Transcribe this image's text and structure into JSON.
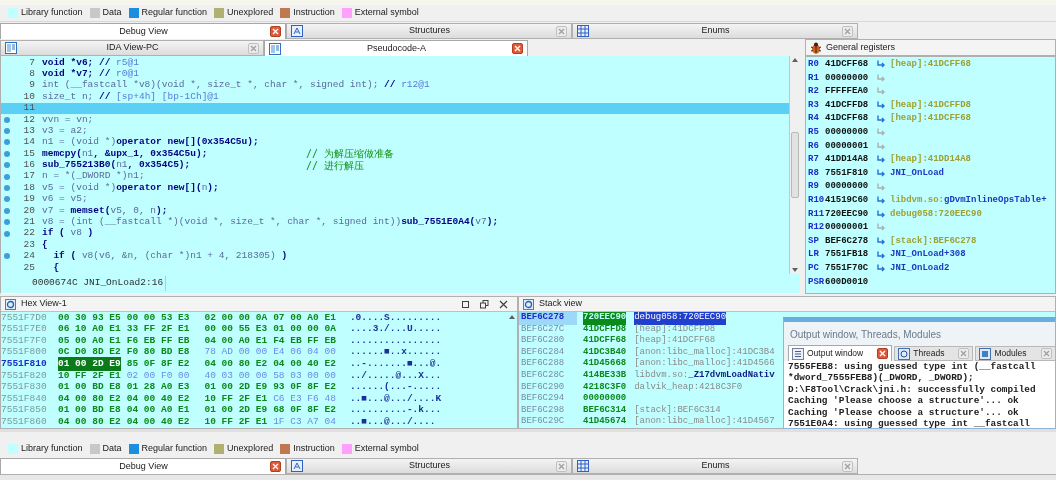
{
  "legend": [
    {
      "label": "Library function",
      "color": "#c0ffff"
    },
    {
      "label": "Data",
      "color": "#c8c8c8"
    },
    {
      "label": "Regular function",
      "color": "#1c8ee0"
    },
    {
      "label": "Unexplored",
      "color": "#b0b070"
    },
    {
      "label": "Instruction",
      "color": "#c07850"
    },
    {
      "label": "External symbol",
      "color": "#ffa0ff"
    }
  ],
  "top_tabs": [
    {
      "label": "Debug View",
      "selected": true
    },
    {
      "label": "Structures",
      "selected": false,
      "kind": "struct"
    },
    {
      "label": "Enums",
      "selected": false,
      "kind": "enum"
    }
  ],
  "editor_tabs": [
    {
      "label": "IDA View-PC",
      "selected": false,
      "kind": "view"
    },
    {
      "label": "Pseudocode-A",
      "selected": true,
      "kind": "view"
    }
  ],
  "pseudocode": {
    "lines": [
      {
        "number": "7",
        "breakpoint": false,
        "selected": false,
        "code": [
          {
            "kind": "kw",
            "text": "void *v6; //"
          },
          {
            "kind": "ref",
            "text": " r5@1"
          }
        ]
      },
      {
        "number": "8",
        "breakpoint": false,
        "selected": false,
        "code": [
          {
            "kind": "kw",
            "text": "void *v7; //"
          },
          {
            "kind": "ref",
            "text": " r0@1"
          }
        ]
      },
      {
        "number": "9",
        "breakpoint": false,
        "selected": false,
        "code": [
          {
            "kind": "id",
            "text": "int (__fastcall *v8)(void *, size_t *, char *, signed int);"
          },
          {
            "kind": "kw",
            "text": " //"
          },
          {
            "kind": "ref",
            "text": " r12@1"
          }
        ]
      },
      {
        "number": "10",
        "breakpoint": false,
        "selected": false,
        "code": [
          {
            "kind": "id",
            "text": "size_t n;"
          },
          {
            "kind": "kw",
            "text": " //"
          },
          {
            "kind": "ref",
            "text": " [sp+4h] [bp-1Ch]@1"
          }
        ]
      },
      {
        "number": "11",
        "breakpoint": false,
        "selected": true
      },
      {
        "number": "12",
        "breakpoint": true,
        "selected": false,
        "code": [
          {
            "kind": "id",
            "text": "vvn = vn;"
          }
        ]
      },
      {
        "number": "13",
        "breakpoint": true,
        "selected": false,
        "code": [
          {
            "kind": "id",
            "text": "v3 = a2;"
          }
        ]
      },
      {
        "number": "14",
        "breakpoint": true,
        "selected": false,
        "code": [
          {
            "kind": "id",
            "text": "n1 = (void *)"
          },
          {
            "kind": "kw",
            "text": "operator new[](0x354C5u);"
          }
        ]
      },
      {
        "number": "15",
        "breakpoint": true,
        "selected": false,
        "code": [
          {
            "kind": "kw",
            "text": "memcpy("
          },
          {
            "kind": "id",
            "text": "n1"
          },
          {
            "kind": "kw",
            "text": ", &upx_1, 0x354C5u);"
          }
        ],
        "comment": "// 为解压缩做准备"
      },
      {
        "number": "16",
        "breakpoint": true,
        "selected": false,
        "code": [
          {
            "kind": "kw",
            "text": "sub_755213B0("
          },
          {
            "kind": "id",
            "text": "n1"
          },
          {
            "kind": "kw",
            "text": ", 0x354C5);"
          }
        ],
        "comment": "// 进行解压"
      },
      {
        "number": "17",
        "breakpoint": true,
        "selected": false,
        "code": [
          {
            "kind": "id",
            "text": "n = *(_DWORD *)n1;"
          }
        ]
      },
      {
        "number": "18",
        "breakpoint": true,
        "selected": false,
        "code": [
          {
            "kind": "id",
            "text": "v5 = (void *)"
          },
          {
            "kind": "kw",
            "text": "operator new[]("
          },
          {
            "kind": "id",
            "text": "n"
          },
          {
            "kind": "kw",
            "text": ");"
          }
        ]
      },
      {
        "number": "19",
        "breakpoint": true,
        "selected": false,
        "code": [
          {
            "kind": "id",
            "text": "v6 = v5;"
          }
        ]
      },
      {
        "number": "20",
        "breakpoint": true,
        "selected": false,
        "code": [
          {
            "kind": "id",
            "text": "v7 = "
          },
          {
            "kind": "kw",
            "text": "memset("
          },
          {
            "kind": "id",
            "text": "v5, 0, n"
          },
          {
            "kind": "kw",
            "text": ");"
          }
        ]
      },
      {
        "number": "21",
        "breakpoint": true,
        "selected": false,
        "code": [
          {
            "kind": "id",
            "text": "v8 = (int (__fastcall *)(void *, size_t *, char *, signed int))"
          },
          {
            "kind": "kw",
            "text": "sub_7551E0A4("
          },
          {
            "kind": "id",
            "text": "v7"
          },
          {
            "kind": "kw",
            "text": ");"
          }
        ]
      },
      {
        "number": "22",
        "breakpoint": true,
        "selected": false,
        "code": [
          {
            "kind": "kw",
            "text": "if ( "
          },
          {
            "kind": "id",
            "text": "v8"
          },
          {
            "kind": "kw",
            "text": " )"
          }
        ]
      },
      {
        "number": "23",
        "breakpoint": false,
        "selected": false,
        "code": [
          {
            "kind": "kw",
            "text": "{"
          }
        ]
      },
      {
        "number": "24",
        "breakpoint": true,
        "selected": false,
        "code": [
          {
            "kind": "kw",
            "text": "  if ( "
          },
          {
            "kind": "id",
            "text": "v8(v6, &n, (char *)n1 + 4, 218305)"
          },
          {
            "kind": "kw",
            "text": " )"
          }
        ]
      },
      {
        "number": "25",
        "breakpoint": false,
        "selected": false,
        "code": [
          {
            "kind": "kw",
            "text": "  {"
          }
        ]
      }
    ],
    "status": "0000674C JNI_OnLoad2:16"
  },
  "registers": {
    "title": "General registers",
    "rows": [
      {
        "name": "R0",
        "value": "41DCFF68",
        "arrow": true,
        "reference": "[heap]:41DCFF68",
        "kind": "data"
      },
      {
        "name": "R1",
        "value": "00000000",
        "arrow": true
      },
      {
        "name": "R2",
        "value": "FFFFFEA0",
        "arrow": true
      },
      {
        "name": "R3",
        "value": "41DCFFD8",
        "arrow": true,
        "reference": "[heap]:41DCFFD8",
        "kind": "data"
      },
      {
        "name": "R4",
        "value": "41DCFF68",
        "arrow": true,
        "reference": "[heap]:41DCFF68",
        "kind": "data"
      },
      {
        "name": "R5",
        "value": "00000000",
        "arrow": true
      },
      {
        "name": "R6",
        "value": "00000001",
        "arrow": true
      },
      {
        "name": "R7",
        "value": "41DD14A8",
        "arrow": true,
        "reference": "[heap]:41DD14A8",
        "kind": "data"
      },
      {
        "name": "R8",
        "value": "7551F810",
        "arrow": true,
        "reference": "JNI_OnLoad",
        "kind": "code"
      },
      {
        "name": "R9",
        "value": "00000000",
        "arrow": true
      },
      {
        "name": "R10",
        "value": "41519C60",
        "arrow": true,
        "prefix": "libdvm.so:",
        "reference": "gDvmInlineOpsTable+",
        "kind": "code"
      },
      {
        "name": "R11",
        "value": "720EEC90",
        "arrow": true,
        "reference": "debug058:720EEC90",
        "kind": "data"
      },
      {
        "name": "R12",
        "value": "00000001",
        "arrow": true
      },
      {
        "name": "SP",
        "value": "BEF6C278",
        "arrow": true,
        "reference": "[stack]:BEF6C278",
        "kind": "data"
      },
      {
        "name": "LR",
        "value": "7551FB18",
        "arrow": true,
        "reference": "JNI_OnLoad+308",
        "kind": "code"
      },
      {
        "name": "PC",
        "value": "7551F70C",
        "arrow": true,
        "reference": "JNI_OnLoad2",
        "kind": "code"
      },
      {
        "name": "PSR",
        "value": "600D0010",
        "arrow": false
      }
    ]
  },
  "hex_view": {
    "title": "Hex View-1",
    "rows": [
      {
        "address": "7551F7D0",
        "selected": false,
        "words": [
          {
            "text": "00 30 93 E5",
            "kind": "code",
            "selected": false
          },
          {
            "text": "00 00 53 E3",
            "kind": "code",
            "selected": false
          },
          {
            "text": "02 00 00 0A",
            "kind": "code",
            "selected": false
          },
          {
            "text": "07 00 A0 E1",
            "kind": "code",
            "selected": false
          }
        ],
        "ascii": ".0....S........."
      },
      {
        "address": "7551F7E0",
        "selected": false,
        "words": [
          {
            "text": "06 10 A0 E1",
            "kind": "code",
            "selected": false
          },
          {
            "text": "33 FF 2F E1",
            "kind": "code",
            "selected": false
          },
          {
            "text": "00 00 55 E3",
            "kind": "code",
            "selected": false
          },
          {
            "text": "01 00 00 0A",
            "kind": "code",
            "selected": false
          }
        ],
        "ascii": "....3./...U....."
      },
      {
        "address": "7551F7F0",
        "selected": false,
        "words": [
          {
            "text": "05 00 A0 E1",
            "kind": "code",
            "selected": false
          },
          {
            "text": "F6 EB FF EB",
            "kind": "code",
            "selected": false
          },
          {
            "text": "04 00 A0 E1",
            "kind": "code",
            "selected": false
          },
          {
            "text": "F4 EB FF EB",
            "kind": "code",
            "selected": false
          }
        ],
        "ascii": "................"
      },
      {
        "address": "7551F800",
        "selected": false,
        "words": [
          {
            "text": "0C D0 8D E2",
            "kind": "code",
            "selected": false
          },
          {
            "text": "F0 80 BD E8",
            "kind": "code",
            "selected": false
          },
          {
            "text": "78 AD 00 00",
            "kind": "data",
            "selected": false
          },
          {
            "text": "E4 06 04 00",
            "kind": "data",
            "selected": false
          }
        ],
        "ascii": "......■..x......"
      },
      {
        "address": "7551F810",
        "selected": true,
        "words": [
          {
            "text": "01 00 2D E9",
            "kind": "code",
            "selected": true
          },
          {
            "text": "85 0F 8F E2",
            "kind": "code",
            "selected": false
          },
          {
            "text": "04 00 80 E2",
            "kind": "code",
            "selected": false
          },
          {
            "text": "04 00 40 E2",
            "kind": "code",
            "selected": false
          }
        ],
        "ascii": "..-.......■...@."
      },
      {
        "address": "7551F820",
        "selected": false,
        "words": [
          {
            "text": "10 FF 2F E1",
            "kind": "code",
            "selected": false
          },
          {
            "text": "02 00 F0 00",
            "kind": "data",
            "selected": false
          },
          {
            "text": "40 03 00 00",
            "kind": "data",
            "selected": false
          },
          {
            "text": "58 03 00 00",
            "kind": "data",
            "selected": false
          }
        ],
        "ascii": "../.....@...X..."
      },
      {
        "address": "7551F830",
        "selected": false,
        "words": [
          {
            "text": "01 00 BD E8",
            "kind": "code",
            "selected": false
          },
          {
            "text": "01 28 A0 E3",
            "kind": "code",
            "selected": false
          },
          {
            "text": "01 00 2D E9",
            "kind": "code",
            "selected": false
          },
          {
            "text": "93 0F 8F E2",
            "kind": "code",
            "selected": false
          }
        ],
        "ascii": "......(...-....."
      },
      {
        "address": "7551F840",
        "selected": false,
        "words": [
          {
            "text": "04 00 80 E2",
            "kind": "code",
            "selected": false
          },
          {
            "text": "04 00 40 E2",
            "kind": "code",
            "selected": false
          },
          {
            "text": "10 FF 2F E1",
            "kind": "code",
            "selected": false
          },
          {
            "text": "C6 E3 F6 48",
            "kind": "data",
            "selected": false
          }
        ],
        "ascii": "..■...@.../....K"
      },
      {
        "address": "7551F850",
        "selected": false,
        "words": [
          {
            "text": "01 00 BD E8",
            "kind": "code",
            "selected": false
          },
          {
            "text": "04 00 A0 E1",
            "kind": "code",
            "selected": false
          },
          {
            "text": "01 00 2D E9",
            "kind": "code",
            "selected": false
          },
          {
            "text": "68 0F 8F E2",
            "kind": "code",
            "selected": false
          }
        ],
        "ascii": "..........-.k..."
      },
      {
        "address": "7551F860",
        "selected": false,
        "words": [
          {
            "text": "04 00 80 E2",
            "kind": "code",
            "selected": false
          },
          {
            "text": "04 00 40 E2",
            "kind": "code",
            "selected": false
          },
          {
            "text": "10 FF 2F E1",
            "kind": "code",
            "selected": false
          },
          {
            "text": "1F C3 A7 04",
            "kind": "data",
            "selected": false
          }
        ],
        "ascii": "..■...@.../...."
      }
    ]
  },
  "stack_view": {
    "title": "Stack view",
    "rows": [
      {
        "address": "BEF6C278",
        "value": "720EEC90",
        "reference": "debug058:720EEC90",
        "selected": true
      },
      {
        "address": "BEF6C27C",
        "value": "41DCFFD8",
        "reference": "[heap]:41DCFFD8",
        "selected": false
      },
      {
        "address": "BEF6C280",
        "value": "41DCFF68",
        "reference": "[heap]:41DCFF68",
        "selected": false
      },
      {
        "address": "BEF6C284",
        "value": "41DC3B40",
        "reference": "[anon:libc_malloc]:41DC3B4",
        "selected": false
      },
      {
        "address": "BEF6C288",
        "value": "41D45668",
        "reference": "[anon:libc_malloc]:41D4566",
        "selected": false
      },
      {
        "address": "BEF6C28C",
        "value": "414BE33B",
        "reference": "libdvm.so:**_Z17dvmLoadNativ**",
        "selected": false
      },
      {
        "address": "BEF6C290",
        "value": "4218C3F0",
        "reference": "dalvik_heap:4218C3F0",
        "selected": false
      },
      {
        "address": "BEF6C294",
        "value": "00000000",
        "selected": false
      },
      {
        "address": "BEF6C298",
        "value": "BEF6C314",
        "reference": "[stack]:BEF6C314",
        "selected": false
      },
      {
        "address": "BEF6C29C",
        "value": "41D45674",
        "reference": "[anon:libc_malloc]:41D4567",
        "selected": false
      }
    ]
  },
  "output_window": {
    "title": "Output window, Threads, Modules",
    "tabs": [
      {
        "label": "Output window",
        "selected": true,
        "kind": "list"
      },
      {
        "label": "Threads",
        "selected": false,
        "kind": "threads"
      },
      {
        "label": "Modules",
        "selected": false,
        "kind": "modules"
      }
    ],
    "lines": [
      "7555FEB8: using guessed type int (__fastcall",
      "*dword_7555FEB8)(_DWORD, _DWORD);",
      "D:\\F8Tool\\Crack\\jni.h: successfully compiled",
      "Caching 'Please choose a structure'... ok",
      "Caching 'Please choose a structure'... ok",
      "7551E0A4: using guessed type int __fastcall"
    ]
  },
  "bottom_legend": [
    {
      "label": "Library function",
      "color": "#c0ffff"
    },
    {
      "label": "Data",
      "color": "#c8c8c8"
    },
    {
      "label": "Regular function",
      "color": "#1c8ee0"
    },
    {
      "label": "Unexplored",
      "color": "#b0b070"
    },
    {
      "label": "Instruction",
      "color": "#c07850"
    },
    {
      "label": "External symbol",
      "color": "#ffa0ff"
    }
  ],
  "bottom_tabs": [
    {
      "label": "Debug View",
      "selected": true
    },
    {
      "label": "Structures",
      "selected": false,
      "kind": "struct"
    },
    {
      "label": "Enums",
      "selected": false,
      "kind": "enum"
    }
  ]
}
